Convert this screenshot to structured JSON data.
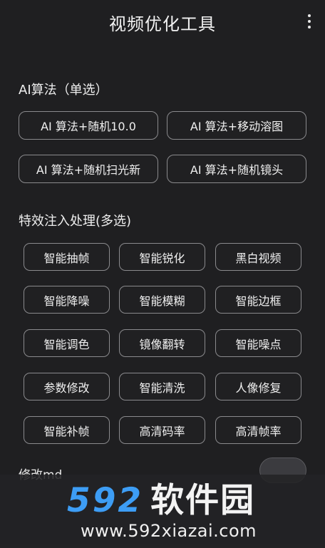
{
  "header": {
    "title": "视频优化工具",
    "menu_icon": "more-vertical-icon"
  },
  "algo": {
    "title": "AI算法（单选）",
    "options": [
      "AI 算法+随机10.0",
      "AI 算法+移动溶图",
      "AI 算法+随机扫光新",
      "AI 算法+随机镜头"
    ]
  },
  "effects": {
    "title": "特效注入处理(多选)",
    "options": [
      "智能抽帧",
      "智能锐化",
      "黑白视频",
      "智能降噪",
      "智能模糊",
      "智能边框",
      "智能调色",
      "镜像翻转",
      "智能噪点",
      "参数修改",
      "智能清洗",
      "人像修复",
      "智能补帧",
      "高清码率",
      "高清帧率"
    ]
  },
  "bottom": {
    "label": "修改md"
  },
  "watermark": {
    "logo_num": "592",
    "logo_cn": "软件园",
    "url": "www.592xiazai.com"
  }
}
